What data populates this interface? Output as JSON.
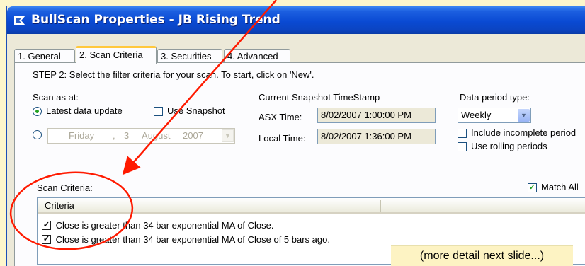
{
  "window": {
    "title": "BullScan Properties - JB Rising Trend"
  },
  "tabs": [
    {
      "label": "1. General"
    },
    {
      "label": "2. Scan Criteria"
    },
    {
      "label": "3. Securities"
    },
    {
      "label": "4. Advanced"
    }
  ],
  "step_text": "STEP 2: Select the filter criteria for your scan. To start, click on 'New'.",
  "scan_as_at": {
    "label": "Scan as at:",
    "latest_label": "Latest data update",
    "use_snapshot_label": "Use Snapshot",
    "date": {
      "day": "Friday",
      "date": "3",
      "month": "August",
      "year": "2007"
    }
  },
  "snapshot": {
    "heading": "Current Snapshot TimeStamp",
    "asx_label": "ASX Time:",
    "asx_value": "8/02/2007 1:00:00 PM",
    "local_label": "Local Time:",
    "local_value": "8/02/2007 1:36:00 PM"
  },
  "data_period": {
    "label": "Data period type:",
    "selected": "Weekly",
    "include_incomplete_label": "Include incomplete period",
    "rolling_label": "Use rolling periods"
  },
  "criteria": {
    "section_label": "Scan Criteria:",
    "match_all_label": "Match All",
    "column_header": "Criteria",
    "rows": [
      {
        "text": "Close is greater than 34 bar exponential MA of Close."
      },
      {
        "text": "Close is greater than 34 bar exponential MA of Close of 5 bars ago."
      }
    ]
  },
  "note": "(more detail next slide...)",
  "colors": {
    "annotation": "#ff1a00",
    "background": "#fdf6cc",
    "titlebar": "#0a4ad3"
  }
}
